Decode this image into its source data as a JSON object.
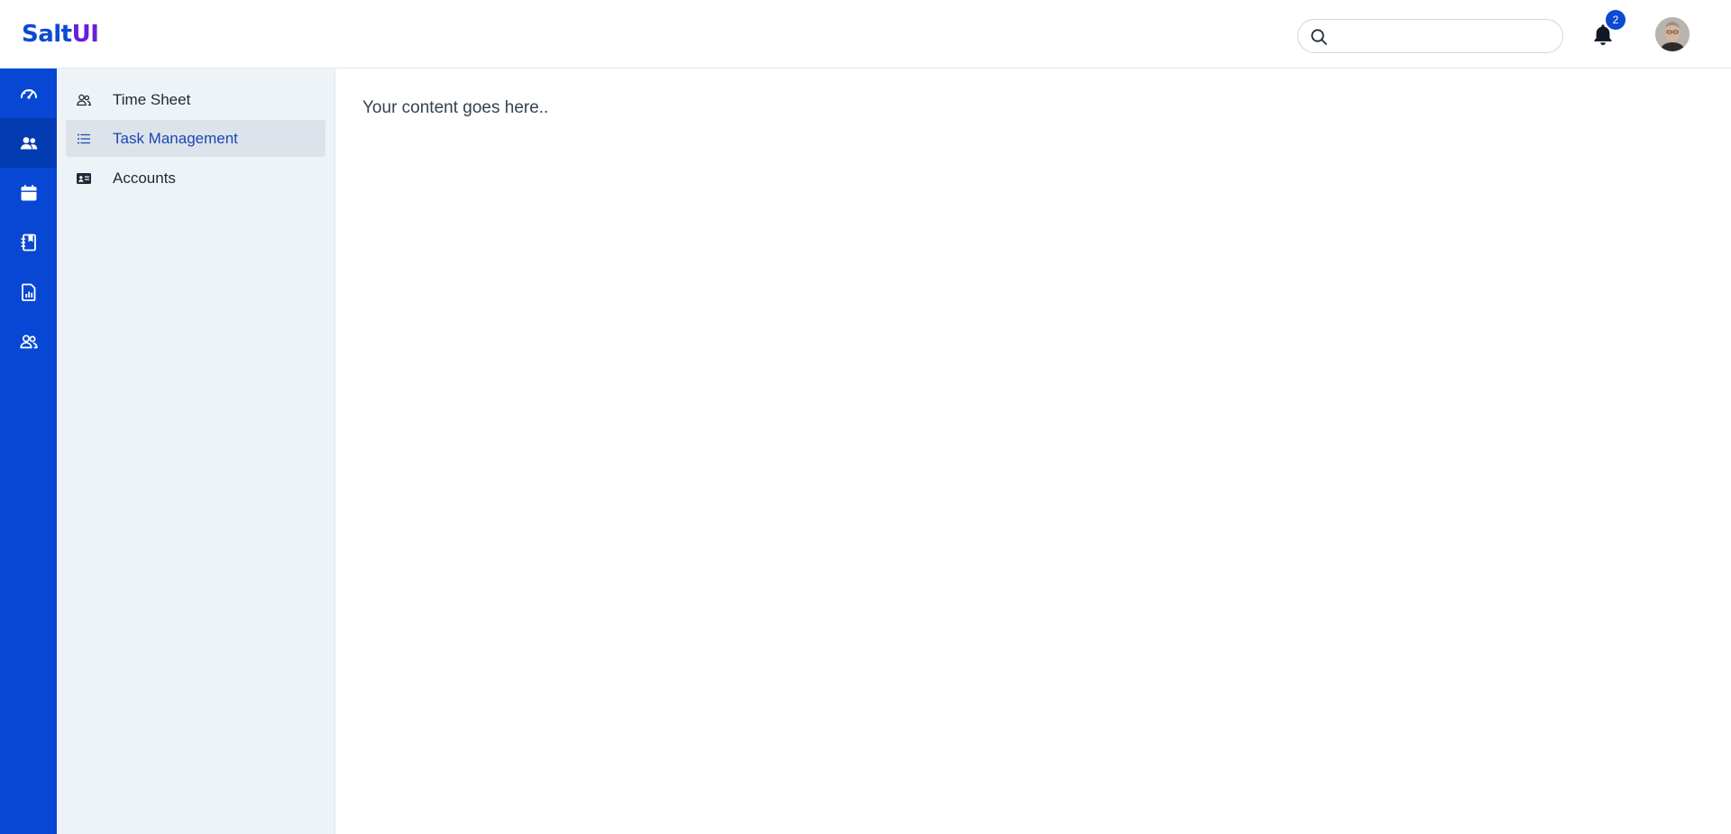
{
  "header": {
    "logo_primary": "Salt",
    "logo_secondary": "UI",
    "search": {
      "placeholder": "",
      "value": ""
    },
    "notifications": {
      "count": "2",
      "icon": "bell-icon"
    },
    "avatar": {
      "icon": "user-avatar"
    }
  },
  "rail": {
    "items": [
      {
        "icon": "dashboard-gauge-icon",
        "active": false
      },
      {
        "icon": "people-icon",
        "active": true
      },
      {
        "icon": "calendar-icon",
        "active": false
      },
      {
        "icon": "journal-bookmark-icon",
        "active": false
      },
      {
        "icon": "report-chart-icon",
        "active": false
      },
      {
        "icon": "people-outline-icon",
        "active": false
      }
    ]
  },
  "subnav": {
    "items": [
      {
        "label": "Time Sheet",
        "icon": "people-icon",
        "active": false
      },
      {
        "label": "Task Management",
        "icon": "list-icon",
        "active": true
      },
      {
        "label": "Accounts",
        "icon": "id-card-icon",
        "active": false
      }
    ]
  },
  "main": {
    "content_text": "Your content goes here.."
  },
  "colors": {
    "brand_blue": "#0747d4",
    "rail_active": "#033bb3",
    "logo_accent": "#6a1fd6",
    "subnav_bg": "#eef3f8",
    "active_item_bg": "#dde3ea",
    "active_item_text": "#1848b3"
  }
}
